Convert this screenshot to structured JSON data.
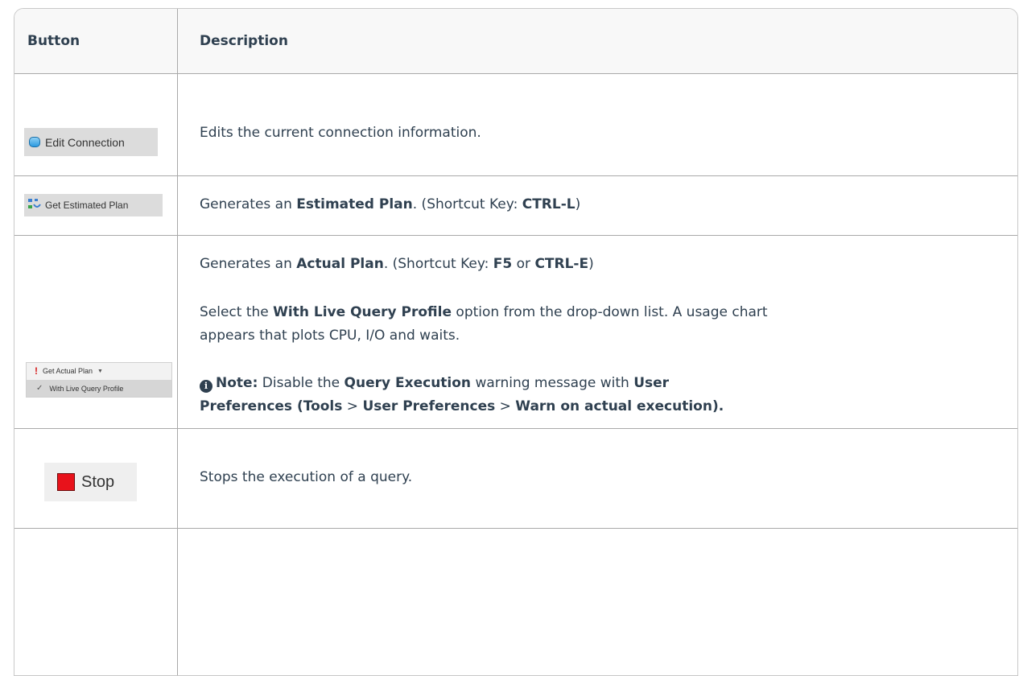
{
  "header": {
    "button_col": "Button",
    "description_col": "Description"
  },
  "rows": [
    {
      "button_label": "Edit Connection",
      "description": "Edits the current connection information."
    },
    {
      "button_label": "Get Estimated Plan",
      "desc_prefix": "Generates an ",
      "desc_bold": "Estimated Plan",
      "desc_mid": ". (Shortcut Key: ",
      "desc_key": "CTRL-L",
      "desc_end": ")"
    },
    {
      "button_label": "Get Actual Plan",
      "dropdown_option": "With Live Query Profile",
      "line1_prefix": "Generates an ",
      "line1_bold": "Actual Plan",
      "line1_mid": ". (Shortcut Key: ",
      "line1_key1": "F5",
      "line1_or": " or ",
      "line1_key2": "CTRL-E",
      "line1_end": ")",
      "line2_prefix": "Select the ",
      "line2_bold": "With Live Query Profile",
      "line2_suffix": " option from the drop-down list. A usage chart",
      "line3": "appears that plots CPU, I/O and waits.",
      "note_label": "Note:",
      "note_prefix": "  Disable the ",
      "note_bold1": "Query Execution",
      "note_mid1": " warning message with ",
      "note_bold2": "User",
      "note_bold3": "Preferences (Tools",
      "note_sep1": " > ",
      "note_bold4": "User Preferences",
      "note_sep2": " > ",
      "note_bold5": "Warn on actual execution)."
    },
    {
      "button_label": "Stop",
      "description": "Stops the execution of a query."
    }
  ],
  "colors": {
    "stop_red": "#e8121b",
    "text": "#2f4050",
    "header_bg": "#f8f8f8"
  },
  "icons": [
    "database-icon",
    "estimated-plan-icon",
    "exclamation-icon",
    "checkmark-icon",
    "stop-icon",
    "info-icon"
  ]
}
